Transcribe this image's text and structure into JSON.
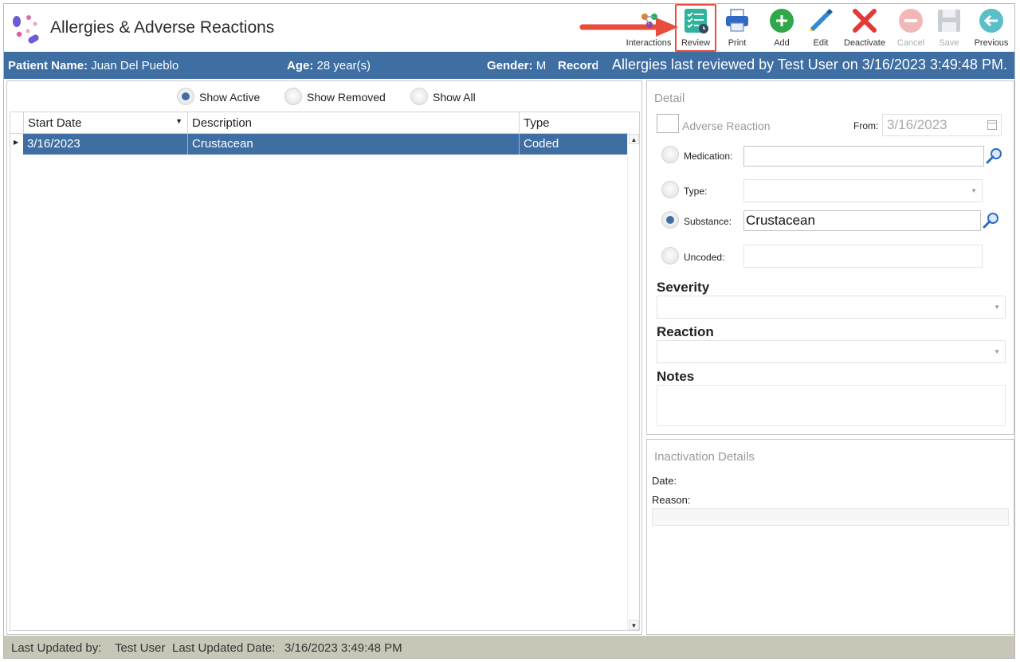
{
  "header": {
    "title": "Allergies & Adverse Reactions",
    "logo_icon": "pills-icon"
  },
  "toolbar": {
    "interactions": "Interactions",
    "review": "Review",
    "print": "Print",
    "add": "Add",
    "edit": "Edit",
    "deactivate": "Deactivate",
    "cancel": "Cancel",
    "save": "Save",
    "previous": "Previous"
  },
  "patient": {
    "name_label": "Patient Name:",
    "name": "Juan Del Pueblo",
    "age_label": "Age:",
    "age": "28 year(s)",
    "gender_label": "Gender:",
    "gender": "M",
    "record_label": "Record",
    "review_note": "Allergies last reviewed by Test User on 3/16/2023 3:49:48 PM."
  },
  "filters": {
    "show_active": "Show Active",
    "show_removed": "Show Removed",
    "show_all": "Show All",
    "selected": "Show Active"
  },
  "grid": {
    "columns": [
      "Start Date",
      "Description",
      "Type"
    ],
    "rows": [
      {
        "start_date": "3/16/2023",
        "description": "Crustacean",
        "type": "Coded"
      }
    ]
  },
  "detail": {
    "title": "Detail",
    "adverse_reaction_label": "Adverse Reaction",
    "from_label": "From:",
    "from_value": "3/16/2023",
    "medication_label": "Medication:",
    "medication_value": "",
    "type_label": "Type:",
    "type_value": "",
    "substance_label": "Substance:",
    "substance_value": "Crustacean",
    "uncoded_label": "Uncoded:",
    "uncoded_value": "",
    "severity_label": "Severity",
    "reaction_label": "Reaction",
    "notes_label": "Notes"
  },
  "inactivation": {
    "title": "Inactivation Details",
    "date_label": "Date:",
    "reason_label": "Reason:"
  },
  "status": {
    "updated_by_label": "Last Updated by:",
    "updated_by": "Test User",
    "updated_date_label": "Last Updated Date:",
    "updated_date": "3/16/2023 3:49:48 PM"
  },
  "colors": {
    "accent": "#3f6ea3",
    "highlight": "#e74c3c",
    "status_bar": "#c8c7b7"
  }
}
